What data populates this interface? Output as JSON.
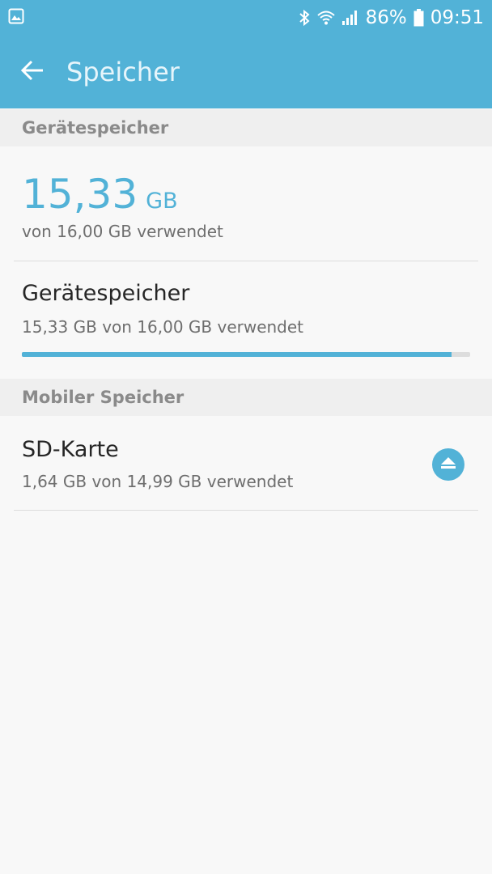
{
  "status_bar": {
    "left_icon": "image-notification-icon",
    "bluetooth_icon": "bluetooth-icon",
    "wifi_icon": "wifi-icon",
    "signal_icon": "signal-icon",
    "battery_percent": "86%",
    "battery_icon": "battery-icon",
    "time": "09:51"
  },
  "app_bar": {
    "back_icon": "arrow-left-icon",
    "title": "Speicher"
  },
  "sections": {
    "device_header": "Gerätespeicher",
    "mobile_header": "Mobiler Speicher"
  },
  "summary": {
    "used_value": "15,33",
    "used_unit": "GB",
    "subtitle": "von 16,00 GB verwendet"
  },
  "device_storage": {
    "title": "Gerätespeicher",
    "subtitle": "15,33 GB von 16,00 GB verwendet",
    "used_fraction": 0.958
  },
  "sd_card": {
    "title": "SD-Karte",
    "subtitle": "1,64 GB von 14,99 GB verwendet",
    "eject_icon": "eject-icon"
  },
  "colors": {
    "accent": "#52b2d7",
    "section_bg": "#efefef",
    "background": "#f8f8f8"
  }
}
